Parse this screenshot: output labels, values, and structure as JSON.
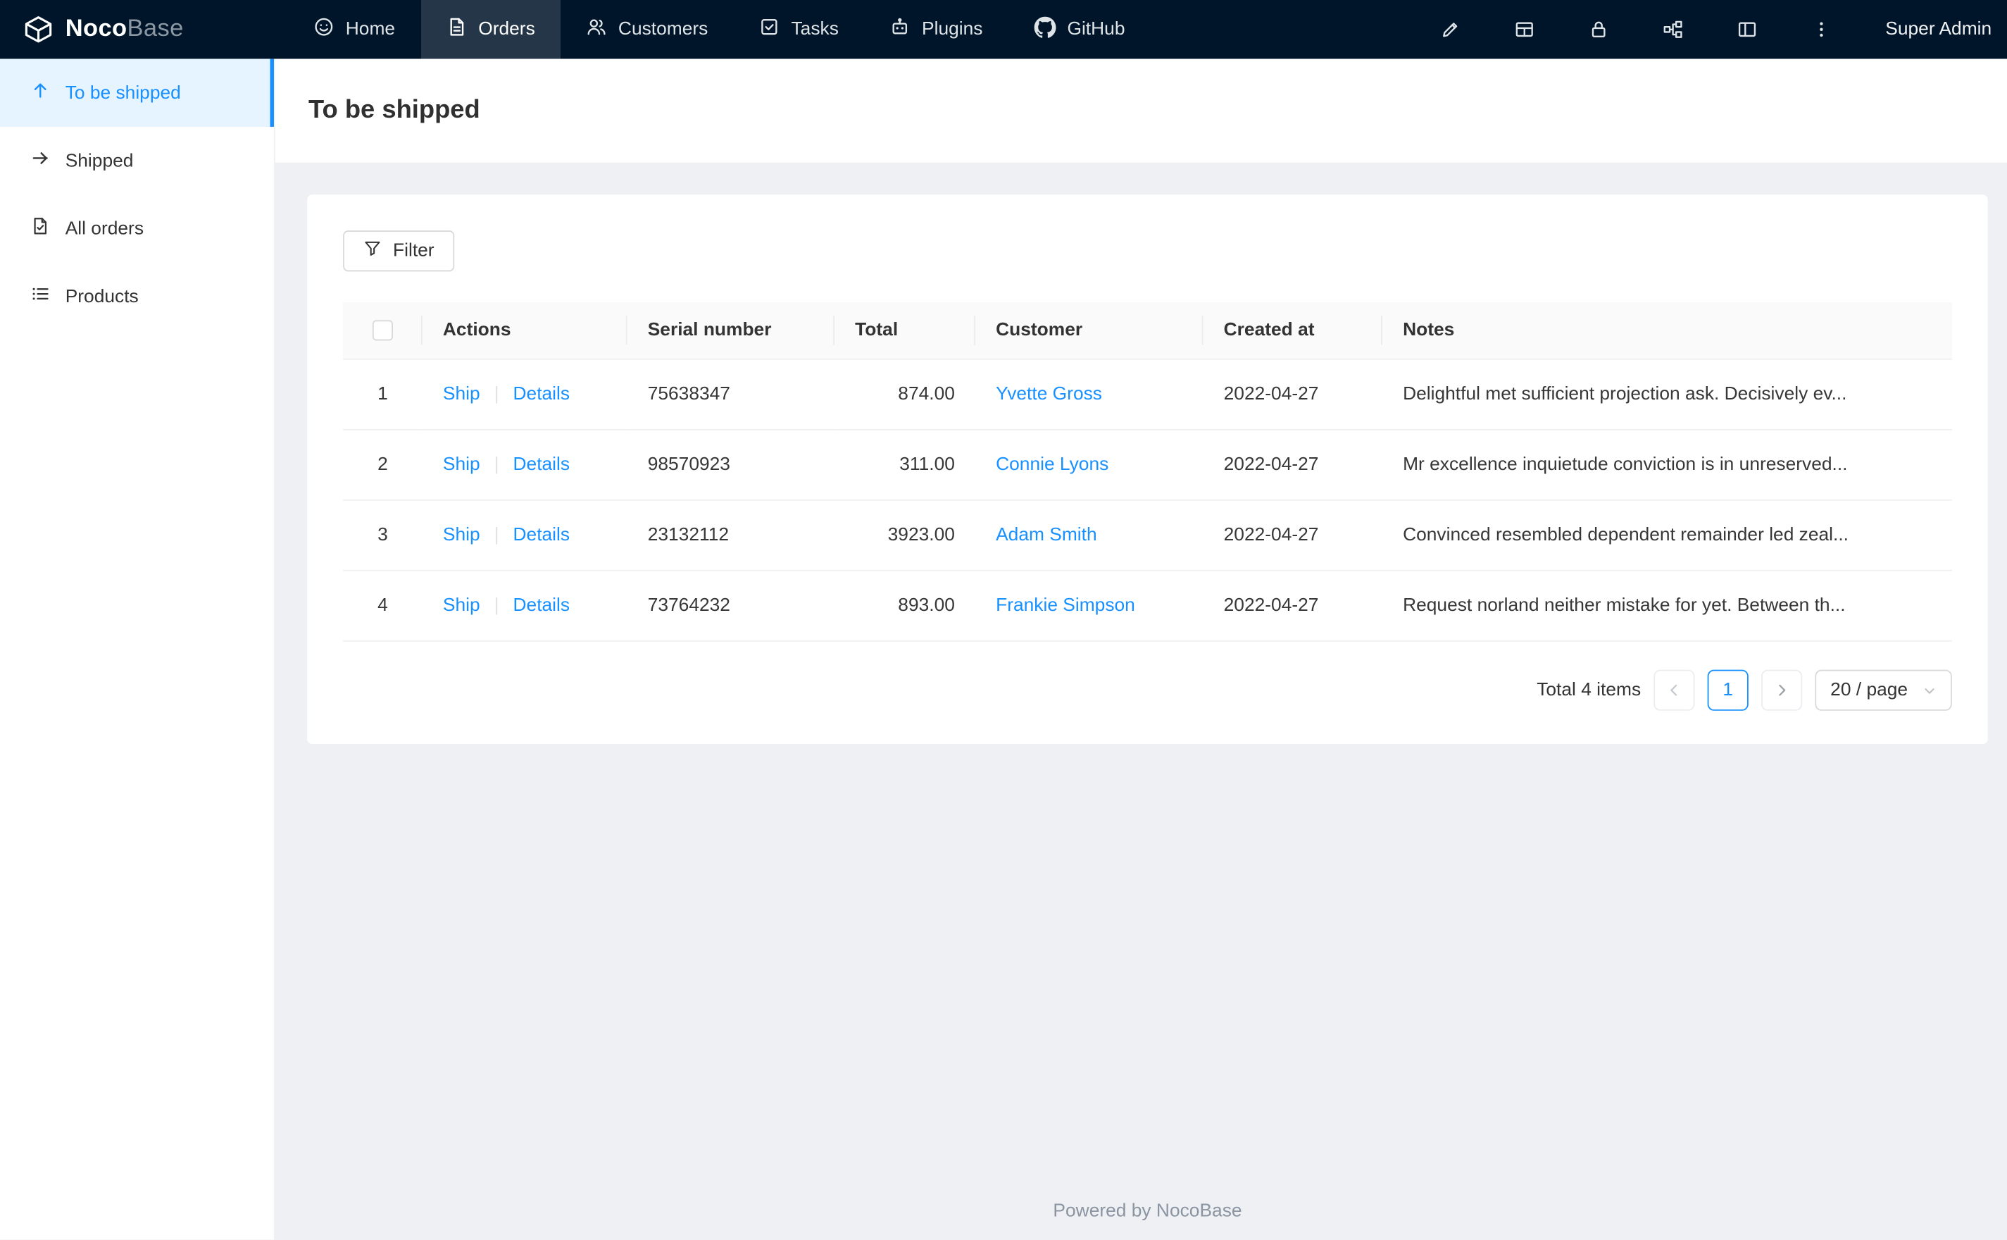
{
  "colors": {
    "accent": "#1890ff",
    "header_bg": "#001529",
    "sidebar_active_bg": "#e6f4ff"
  },
  "navbar": {
    "logo": {
      "noco": "Noco",
      "base": "Base"
    },
    "items": [
      {
        "label": "Home"
      },
      {
        "label": "Orders",
        "active": true
      },
      {
        "label": "Customers"
      },
      {
        "label": "Tasks"
      },
      {
        "label": "Plugins"
      },
      {
        "label": "GitHub"
      }
    ],
    "right_icons": [
      "pen-icon",
      "table-icon",
      "lock-icon",
      "partition-icon",
      "layout-icon",
      "more-icon"
    ],
    "user": "Super Admin"
  },
  "sidebar": {
    "items": [
      {
        "label": "To be shipped",
        "active": true
      },
      {
        "label": "Shipped"
      },
      {
        "label": "All orders"
      },
      {
        "label": "Products"
      }
    ]
  },
  "page": {
    "title": "To be shipped"
  },
  "toolbar": {
    "filter_label": "Filter"
  },
  "table": {
    "columns": [
      "Actions",
      "Serial number",
      "Total",
      "Customer",
      "Created at",
      "Notes"
    ],
    "row_actions": {
      "ship": "Ship",
      "details": "Details"
    },
    "rows": [
      {
        "index": "1",
        "serial": "75638347",
        "total": "874.00",
        "customer": "Yvette Gross",
        "created_at": "2022-04-27",
        "notes": "Delightful met sufficient projection ask. Decisively ev..."
      },
      {
        "index": "2",
        "serial": "98570923",
        "total": "311.00",
        "customer": "Connie Lyons",
        "created_at": "2022-04-27",
        "notes": "Mr excellence inquietude conviction is in unreserved..."
      },
      {
        "index": "3",
        "serial": "23132112",
        "total": "3923.00",
        "customer": "Adam Smith",
        "created_at": "2022-04-27",
        "notes": "Convinced resembled dependent remainder led zeal..."
      },
      {
        "index": "4",
        "serial": "73764232",
        "total": "893.00",
        "customer": "Frankie Simpson",
        "created_at": "2022-04-27",
        "notes": "Request norland neither mistake for yet. Between th..."
      }
    ]
  },
  "pagination": {
    "total_text": "Total 4 items",
    "current_page": "1",
    "page_size": "20 / page"
  },
  "footer": {
    "text": "Powered by NocoBase"
  }
}
